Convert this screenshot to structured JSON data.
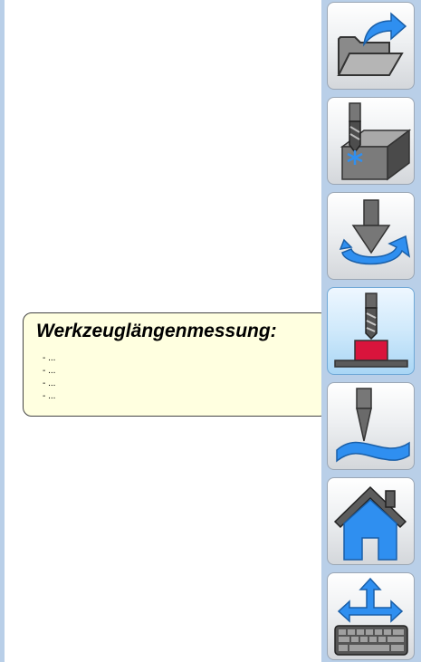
{
  "tooltip": {
    "title": "Werkzeuglängenmessung:",
    "items": [
      "- ...",
      "- ...",
      "- ...",
      "- ..."
    ]
  },
  "toolbar": {
    "buttons": [
      {
        "icon": "open-folder-icon"
      },
      {
        "icon": "tool-workpiece-zero-icon"
      },
      {
        "icon": "tool-rotate-icon"
      },
      {
        "icon": "tool-length-measure-icon",
        "state": "active"
      },
      {
        "icon": "engraving-surface-icon"
      },
      {
        "icon": "home-icon"
      },
      {
        "icon": "move-keyboard-icon"
      }
    ]
  },
  "colors": {
    "toolbar_background": "#b9cfe8",
    "tooltip_background": "#ffffe0",
    "accent_blue": "#2f8ff0",
    "accent_red": "#d9143c"
  }
}
